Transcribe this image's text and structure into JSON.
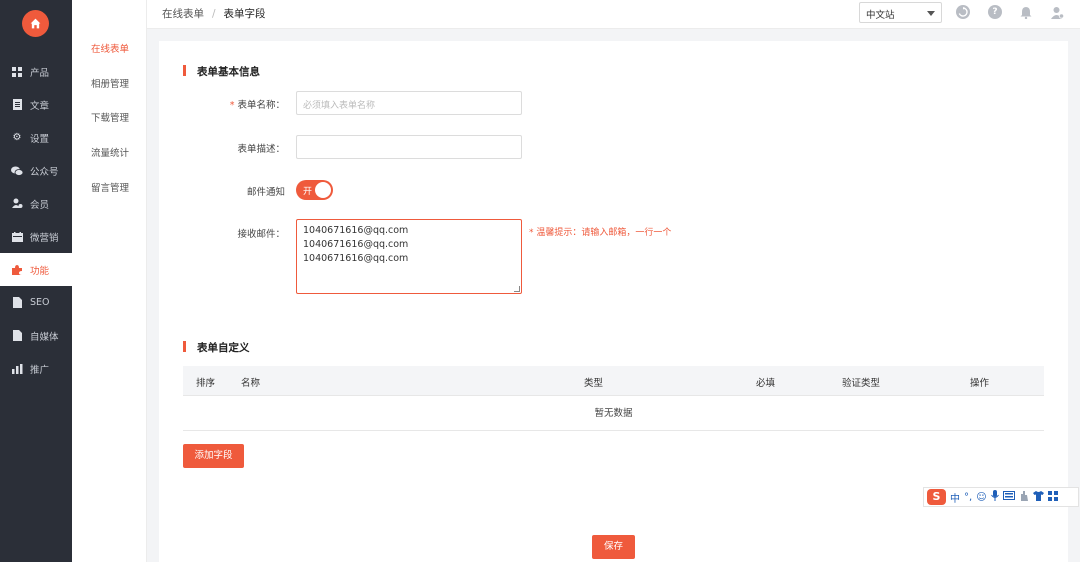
{
  "sidebar": {
    "logo_icon": "home-icon",
    "items": [
      {
        "label": "产品",
        "icon": "grid-icon"
      },
      {
        "label": "文章",
        "icon": "document-icon"
      },
      {
        "label": "设置",
        "icon": "gear-icon"
      },
      {
        "label": "公众号",
        "icon": "wechat-icon"
      },
      {
        "label": "会员",
        "icon": "user-settings-icon"
      },
      {
        "label": "微营销",
        "icon": "calendar-icon"
      },
      {
        "label": "功能",
        "icon": "puzzle-icon"
      },
      {
        "label": "SEO",
        "icon": "file-icon"
      },
      {
        "label": "自媒体",
        "icon": "file-icon"
      },
      {
        "label": "推广",
        "icon": "bar-chart-icon"
      }
    ]
  },
  "subnav": {
    "items": [
      {
        "label": "在线表单"
      },
      {
        "label": "相册管理"
      },
      {
        "label": "下载管理"
      },
      {
        "label": "流量统计"
      },
      {
        "label": "留言管理"
      }
    ]
  },
  "header": {
    "breadcrumb_parent": "在线表单",
    "breadcrumb_separator": "/",
    "breadcrumb_current": "表单字段",
    "language_select": "中文站"
  },
  "form_basic": {
    "section_title": "表单基本信息",
    "name_label": "表单名称：",
    "name_required_mark": "*",
    "name_placeholder": "必须填入表单名称",
    "desc_label": "表单描述：",
    "notify_label": "邮件通知",
    "notify_toggle_text": "开",
    "notify_on": true,
    "recv_label": "接收邮件：",
    "emails": [
      "1040671616@qq.com",
      "1040671616@qq.com",
      "1040671616@qq.com"
    ],
    "hint": "* 温馨提示：请输入邮箱，一行一个"
  },
  "form_custom": {
    "section_title": "表单自定义",
    "columns": [
      "排序",
      "名称",
      "类型",
      "必填",
      "验证类型",
      "操作"
    ],
    "empty_text": "暂无数据",
    "add_button": "添加字段",
    "save_button": "保存"
  },
  "ime_toolbar": {
    "logo": "S",
    "mode": "中",
    "punct": "°,"
  },
  "colors": {
    "accent": "#ef5a3c",
    "sidebar_bg": "#2b2f38"
  }
}
